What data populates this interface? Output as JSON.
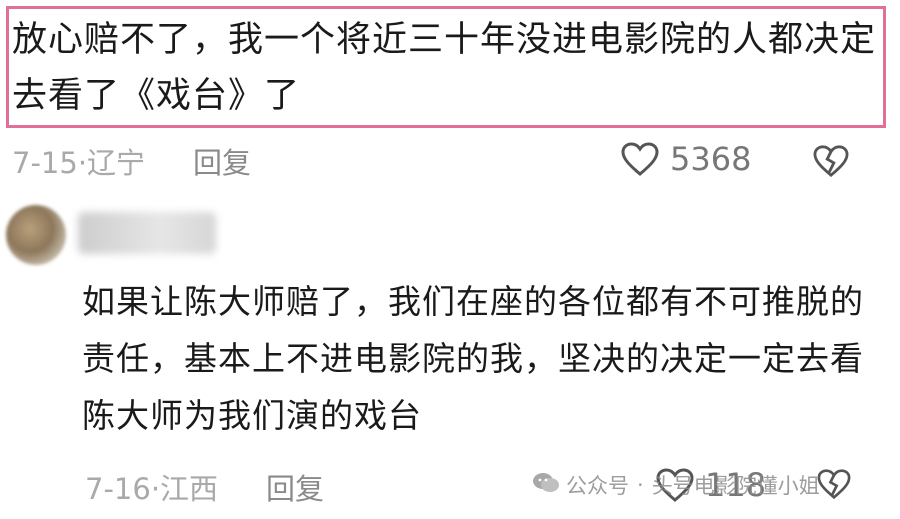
{
  "comment1": {
    "text": "放心赔不了，我一个将近三十年没进电影院的人都决定去看了《戏台》了",
    "date_location": "7-15·辽宁",
    "reply_label": "回复",
    "like_count": "5368",
    "highlight_color": "#e0709a"
  },
  "comment2": {
    "text": "如果让陈大师赔了，我们在座的各位都有不可推脱的责任，基本上不进电影院的我，坚决的决定一定去看陈大师为我们演的戏台",
    "date_location": "7-16·江西",
    "reply_label": "回复",
    "like_count": "118"
  },
  "watermark": {
    "source": "公众号",
    "separator": "·",
    "account": "头号电影院懂小姐"
  }
}
